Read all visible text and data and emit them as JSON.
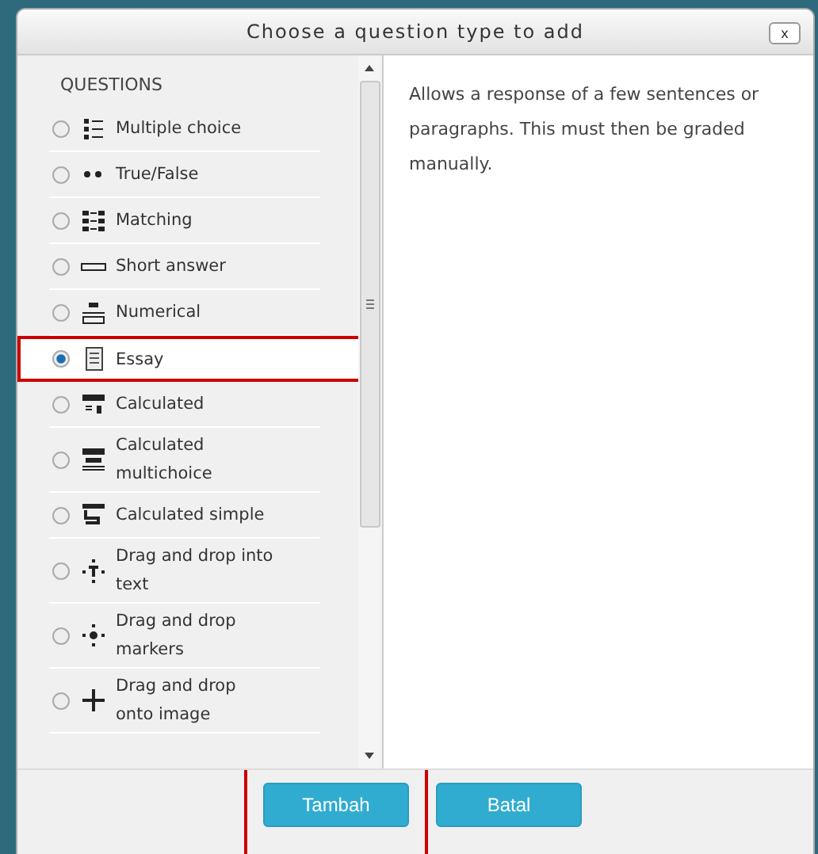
{
  "dialog": {
    "title": "Choose a question type to add",
    "close": "x"
  },
  "section_heading": "QUESTIONS",
  "options": [
    {
      "kind": "multichoice",
      "label": "Multiple choice",
      "selected": false,
      "highlighted": false
    },
    {
      "kind": "truefalse",
      "label": "True/False",
      "selected": false,
      "highlighted": false
    },
    {
      "kind": "matching",
      "label": "Matching",
      "selected": false,
      "highlighted": false
    },
    {
      "kind": "shortanswer",
      "label": "Short answer",
      "selected": false,
      "highlighted": false
    },
    {
      "kind": "numerical",
      "label": "Numerical",
      "selected": false,
      "highlighted": false
    },
    {
      "kind": "essay",
      "label": "Essay",
      "selected": true,
      "highlighted": true
    },
    {
      "kind": "calculated",
      "label": "Calculated",
      "selected": false,
      "highlighted": false
    },
    {
      "kind": "calcmulti",
      "label": "Calculated multichoice",
      "selected": false,
      "highlighted": false
    },
    {
      "kind": "calcsimple",
      "label": "Calculated simple",
      "selected": false,
      "highlighted": false
    },
    {
      "kind": "ddtext",
      "label": "Drag and drop into text",
      "selected": false,
      "highlighted": false
    },
    {
      "kind": "ddmarker",
      "label": "Drag and drop markers",
      "selected": false,
      "highlighted": false
    },
    {
      "kind": "ddimage",
      "label": "Drag and drop onto image",
      "selected": false,
      "highlighted": false
    }
  ],
  "description": "Allows a response of a few sentences or paragraphs. This must then be graded manually.",
  "buttons": [
    {
      "label": "Tambah",
      "highlighted": true
    },
    {
      "label": "Batal",
      "highlighted": false
    }
  ]
}
